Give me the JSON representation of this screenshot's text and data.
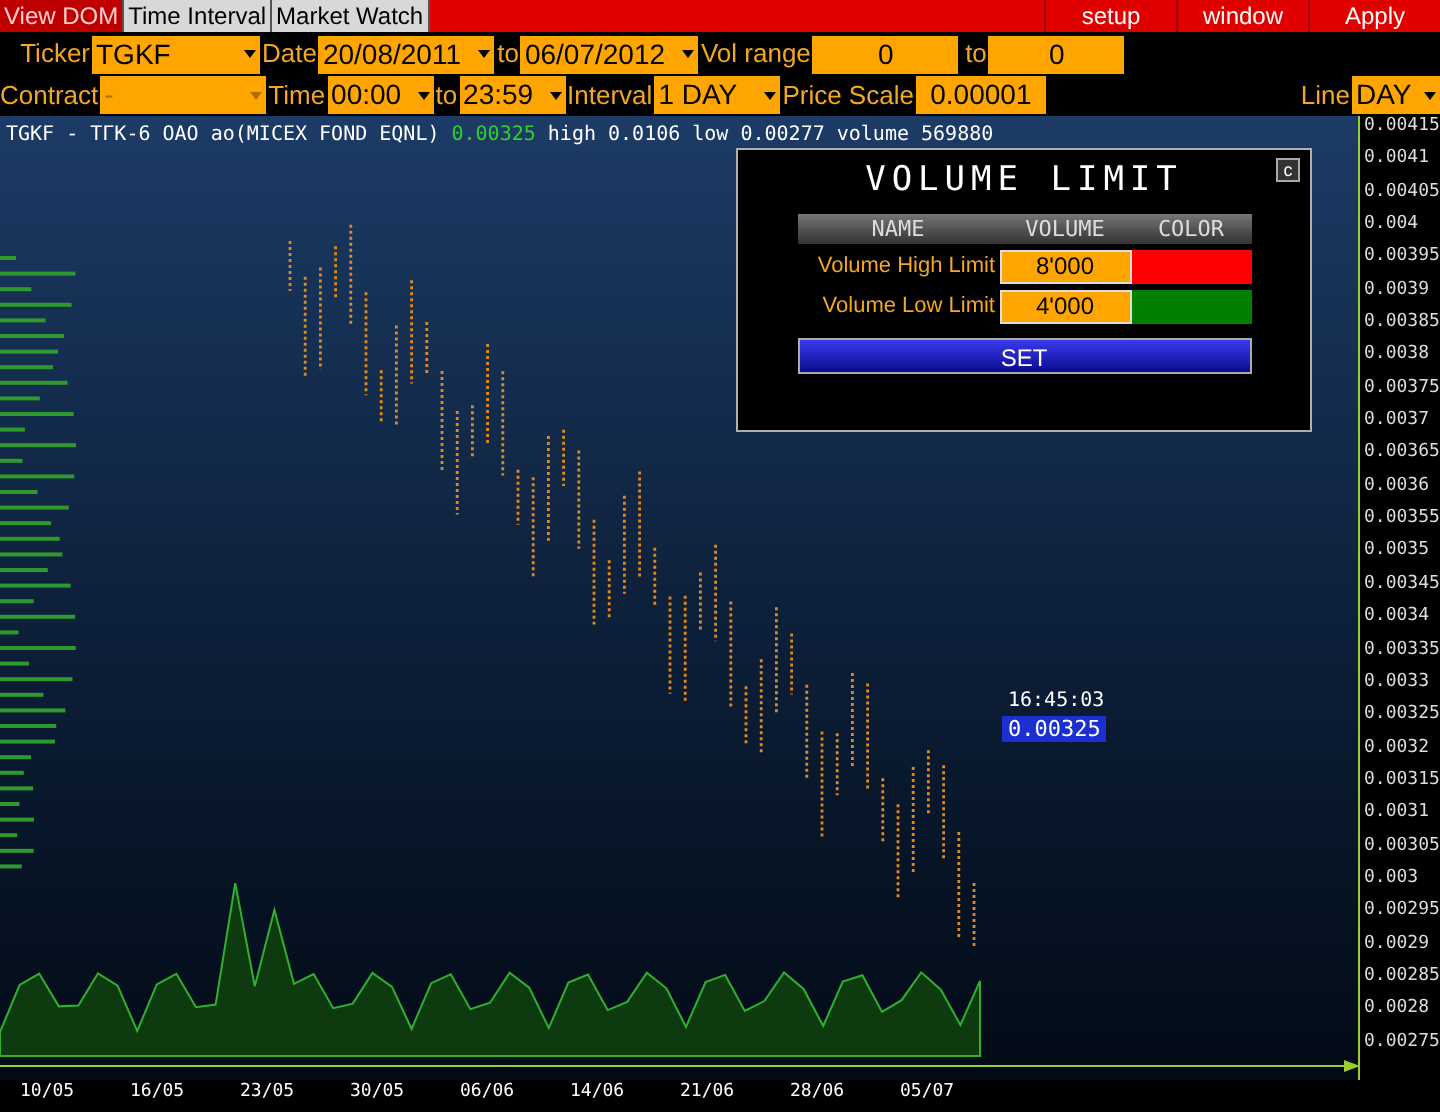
{
  "menu_bar": {
    "tabs": [
      {
        "label": "View DOM",
        "selected": false
      },
      {
        "label": "Time Interval",
        "selected": true
      },
      {
        "label": "Market Watch",
        "selected": true
      }
    ],
    "actions": [
      "setup",
      "window",
      "Apply"
    ]
  },
  "filters": {
    "row_1": [
      {
        "kind": "dropdown",
        "label": "Ticker",
        "value": "TGKF"
      },
      {
        "kind": "dropdown",
        "label": "Date",
        "value": "20/08/2011"
      },
      {
        "kind": "dropdown",
        "label": "to",
        "value": "06/07/2012"
      },
      {
        "kind": "input",
        "label": "Vol range",
        "value": "0"
      },
      {
        "kind": "input",
        "label": "to",
        "value": "0"
      }
    ],
    "row_2": [
      {
        "kind": "dropdown",
        "label": "Contract",
        "value": "-",
        "disabled": true
      },
      {
        "kind": "dropdown",
        "label": "Time",
        "value": "00:00"
      },
      {
        "kind": "dropdown",
        "label": "to",
        "value": "23:59"
      },
      {
        "kind": "dropdown",
        "label": "Interval",
        "value": "1 DAY"
      },
      {
        "kind": "input",
        "label": "Price Scale",
        "value": "0.00001"
      }
    ],
    "row_2_right": [
      {
        "kind": "dropdown",
        "label": "Line",
        "value": "DAY"
      }
    ]
  },
  "chart": {
    "instrument": "TGKF - ТГК-6 ОАО ао(MICEX FOND EQNL)",
    "last": "0.00325",
    "high": "high 0.0106",
    "low": "low 0.00277",
    "volume": "volume 569880",
    "y_ticks": [
      "0.00415",
      "0.0041",
      "0.00405",
      "0.004",
      "0.00395",
      "0.0039",
      "0.00385",
      "0.0038",
      "0.00375",
      "0.0037",
      "0.00365",
      "0.0036",
      "0.00355",
      "0.0035",
      "0.00345",
      "0.0034",
      "0.00335",
      "0.0033",
      "0.00325",
      "0.0032",
      "0.00315",
      "0.0031",
      "0.00305",
      "0.003",
      "0.00295",
      "0.0029",
      "0.00285",
      "0.0028",
      "0.00275"
    ],
    "x_labels": [
      "10/05",
      "16/05",
      "23/05",
      "30/05",
      "06/06",
      "14/06",
      "21/06",
      "28/06",
      "05/07"
    ],
    "cursor_time": "16:45:03",
    "cursor_price": "0.00325"
  },
  "dialog": {
    "title": "VOLUME LIMIT",
    "close": "c",
    "columns": [
      "NAME",
      "VOLUME",
      "COLOR"
    ],
    "rows": [
      {
        "name": "Volume High Limit",
        "volume": "8'000",
        "color": "#ff0000"
      },
      {
        "name": "Volume Low Limit",
        "volume": "4'000",
        "color": "#008000"
      }
    ],
    "button": "SET"
  }
}
